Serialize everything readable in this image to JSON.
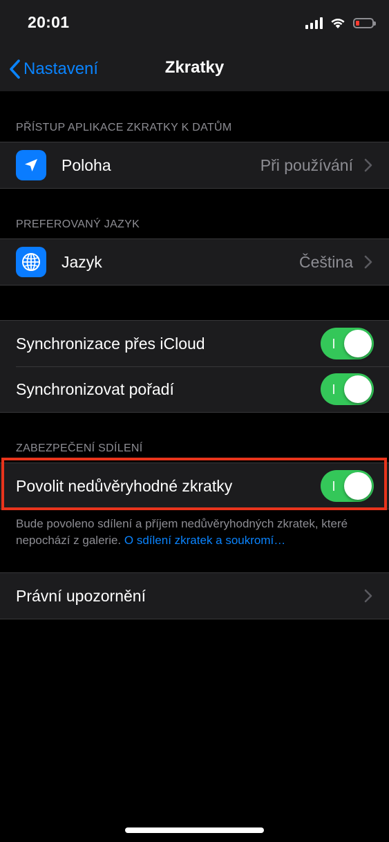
{
  "status_bar": {
    "time": "20:01",
    "icons": [
      "cellular-signal-icon",
      "wifi-icon",
      "battery-low-icon"
    ],
    "battery_color": "#ff3b30"
  },
  "nav": {
    "back_label": "Nastavení",
    "title": "Zkratky"
  },
  "sections": {
    "data_access": {
      "header": "PŘÍSTUP APLIKACE ZKRATKY K DATŮM",
      "location": {
        "label": "Poloha",
        "value": "Při používání",
        "icon": "location-arrow-icon"
      }
    },
    "language": {
      "header": "PREFEROVANÝ JAZYK",
      "language": {
        "label": "Jazyk",
        "value": "Čeština",
        "icon": "globe-icon"
      }
    },
    "sync": {
      "icloud": {
        "label": "Synchronizace přes iCloud",
        "on": true
      },
      "order": {
        "label": "Synchronizovat pořadí",
        "on": true
      }
    },
    "sharing": {
      "header": "ZABEZPEČENÍ SDÍLENÍ",
      "untrusted": {
        "label": "Povolit nedůvěryhodné zkratky",
        "on": true
      },
      "footer_text": "Bude povoleno sdílení a příjem nedůvěryhodných zkratek, které nepochází z galerie. ",
      "footer_link": "O sdílení zkratek a soukromí…"
    },
    "legal": {
      "label": "Právní upozornění"
    }
  },
  "colors": {
    "accent": "#0a84ff",
    "toggle_on": "#34c759",
    "highlight": "#e8341c",
    "cell_background": "#1c1c1e",
    "secondary_text": "#8d8d93"
  }
}
